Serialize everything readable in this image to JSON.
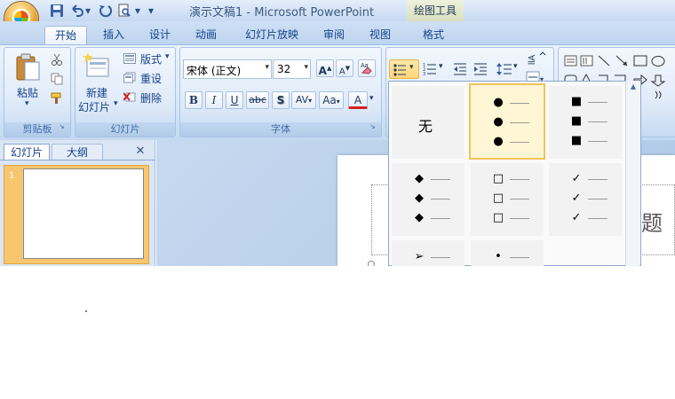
{
  "window": {
    "title": "演示文稿1 - Microsoft PowerPoint",
    "context_tool": "绘图工具"
  },
  "quick_access": {
    "save": "save-icon",
    "undo": "undo-icon",
    "redo": "redo-icon",
    "print_preview": "print-preview-icon",
    "customize": "▾"
  },
  "tabs": [
    {
      "label": "开始",
      "active": true
    },
    {
      "label": "插入"
    },
    {
      "label": "设计"
    },
    {
      "label": "动画"
    },
    {
      "label": "幻灯片放映"
    },
    {
      "label": "审阅"
    },
    {
      "label": "视图"
    },
    {
      "label": "格式"
    }
  ],
  "ribbon": {
    "clipboard": {
      "label": "剪贴板",
      "paste": "粘贴"
    },
    "slides": {
      "label": "幻灯片",
      "new_slide_line1": "新建",
      "new_slide_line2": "幻灯片",
      "layout": "版式",
      "reset": "重设",
      "delete": "删除"
    },
    "font": {
      "label": "字体",
      "font_name": "宋体 (正文)",
      "font_size": "32",
      "bold": "B",
      "italic": "I",
      "underline": "U",
      "strike": "abc",
      "shadow": "S",
      "spacing": "AV",
      "case": "Aa",
      "color": "A",
      "grow": "A",
      "shrink": "A"
    }
  },
  "slide_pane": {
    "tabs": [
      {
        "label": "幻灯片",
        "active": true
      },
      {
        "label": "大纲"
      }
    ],
    "close": "✕",
    "slide_number": "1"
  },
  "bullet_gallery": {
    "items": [
      {
        "label": "无"
      },
      {
        "marker": "●",
        "selected": true
      },
      {
        "marker": "■"
      },
      {
        "marker": "◆"
      },
      {
        "marker": "□"
      },
      {
        "marker": "✓"
      },
      {
        "marker": "➢"
      },
      {
        "marker": "•"
      }
    ],
    "scroll_up": "▲"
  },
  "slide": {
    "title_text_fragment": "题"
  },
  "colors": {
    "ribbon_bg": "#dbe8f8",
    "accent": "#15428b",
    "selection": "#f0c35a"
  }
}
